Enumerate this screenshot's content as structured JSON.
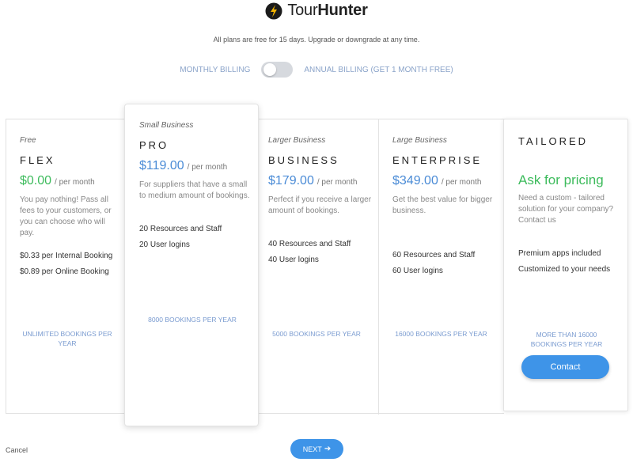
{
  "brand": {
    "name_part1": "Tour",
    "name_part2": "Hunter",
    "logo_icon": "tourhunter-logo-icon"
  },
  "subtitle": "All plans are free for 15 days. Upgrade or downgrade at any time.",
  "billing": {
    "monthly_label": "MONTHLY BILLING",
    "annual_label": "ANNUAL BILLING (GET 1 MONTH FREE)",
    "annual_enabled": false
  },
  "plans": [
    {
      "tier": "Free",
      "name": "FLEX",
      "price": "$0.00",
      "per": "/ per month",
      "description": "You pay nothing! Pass all fees to your customers, or you can choose who will pay.",
      "features": [
        "$0.33 per Internal Booking",
        "$0.89 per Online Booking"
      ],
      "cap": "UNLIMITED BOOKINGS PER YEAR"
    },
    {
      "tier": "Small Business",
      "name": "PRO",
      "price": "$119.00",
      "per": "/ per month",
      "description": "For suppliers that have a small to medium amount of bookings.",
      "features": [
        "20 Resources and Staff",
        "20 User logins"
      ],
      "cap": "8000 BOOKINGS PER YEAR"
    },
    {
      "tier": "Larger Business",
      "name": "BUSINESS",
      "price": "$179.00",
      "per": "/ per month",
      "description": "Perfect if you receive a larger amount of bookings.",
      "features": [
        "40 Resources and Staff",
        "40 User logins"
      ],
      "cap": "5000 BOOKINGS PER YEAR"
    },
    {
      "tier": "Large Business",
      "name": "ENTERPRISE",
      "price": "$349.00",
      "per": "/ per month",
      "description": "Get the best value for bigger business.",
      "features": [
        "60 Resources and Staff",
        "60 User logins"
      ],
      "cap": "16000 BOOKINGS PER YEAR"
    },
    {
      "tier": "",
      "name": "TAILORED",
      "price": "Ask for pricing",
      "per": "",
      "description": "Need a custom - tailored solution for your company? Contact us",
      "features": [
        "Premium apps included",
        "Customized to your needs"
      ],
      "cap": "MORE THAN 16000 BOOKINGS PER YEAR",
      "button": "Contact"
    }
  ],
  "footer": {
    "cancel_label": "Cancel",
    "next_label": "NEXT",
    "next_icon": "arrow-right-icon"
  },
  "colors": {
    "accent_blue": "#3e94e8",
    "price_green": "#3dbb5c",
    "price_blue": "#4a8bd6",
    "cap_blue": "#7a9bd0"
  }
}
